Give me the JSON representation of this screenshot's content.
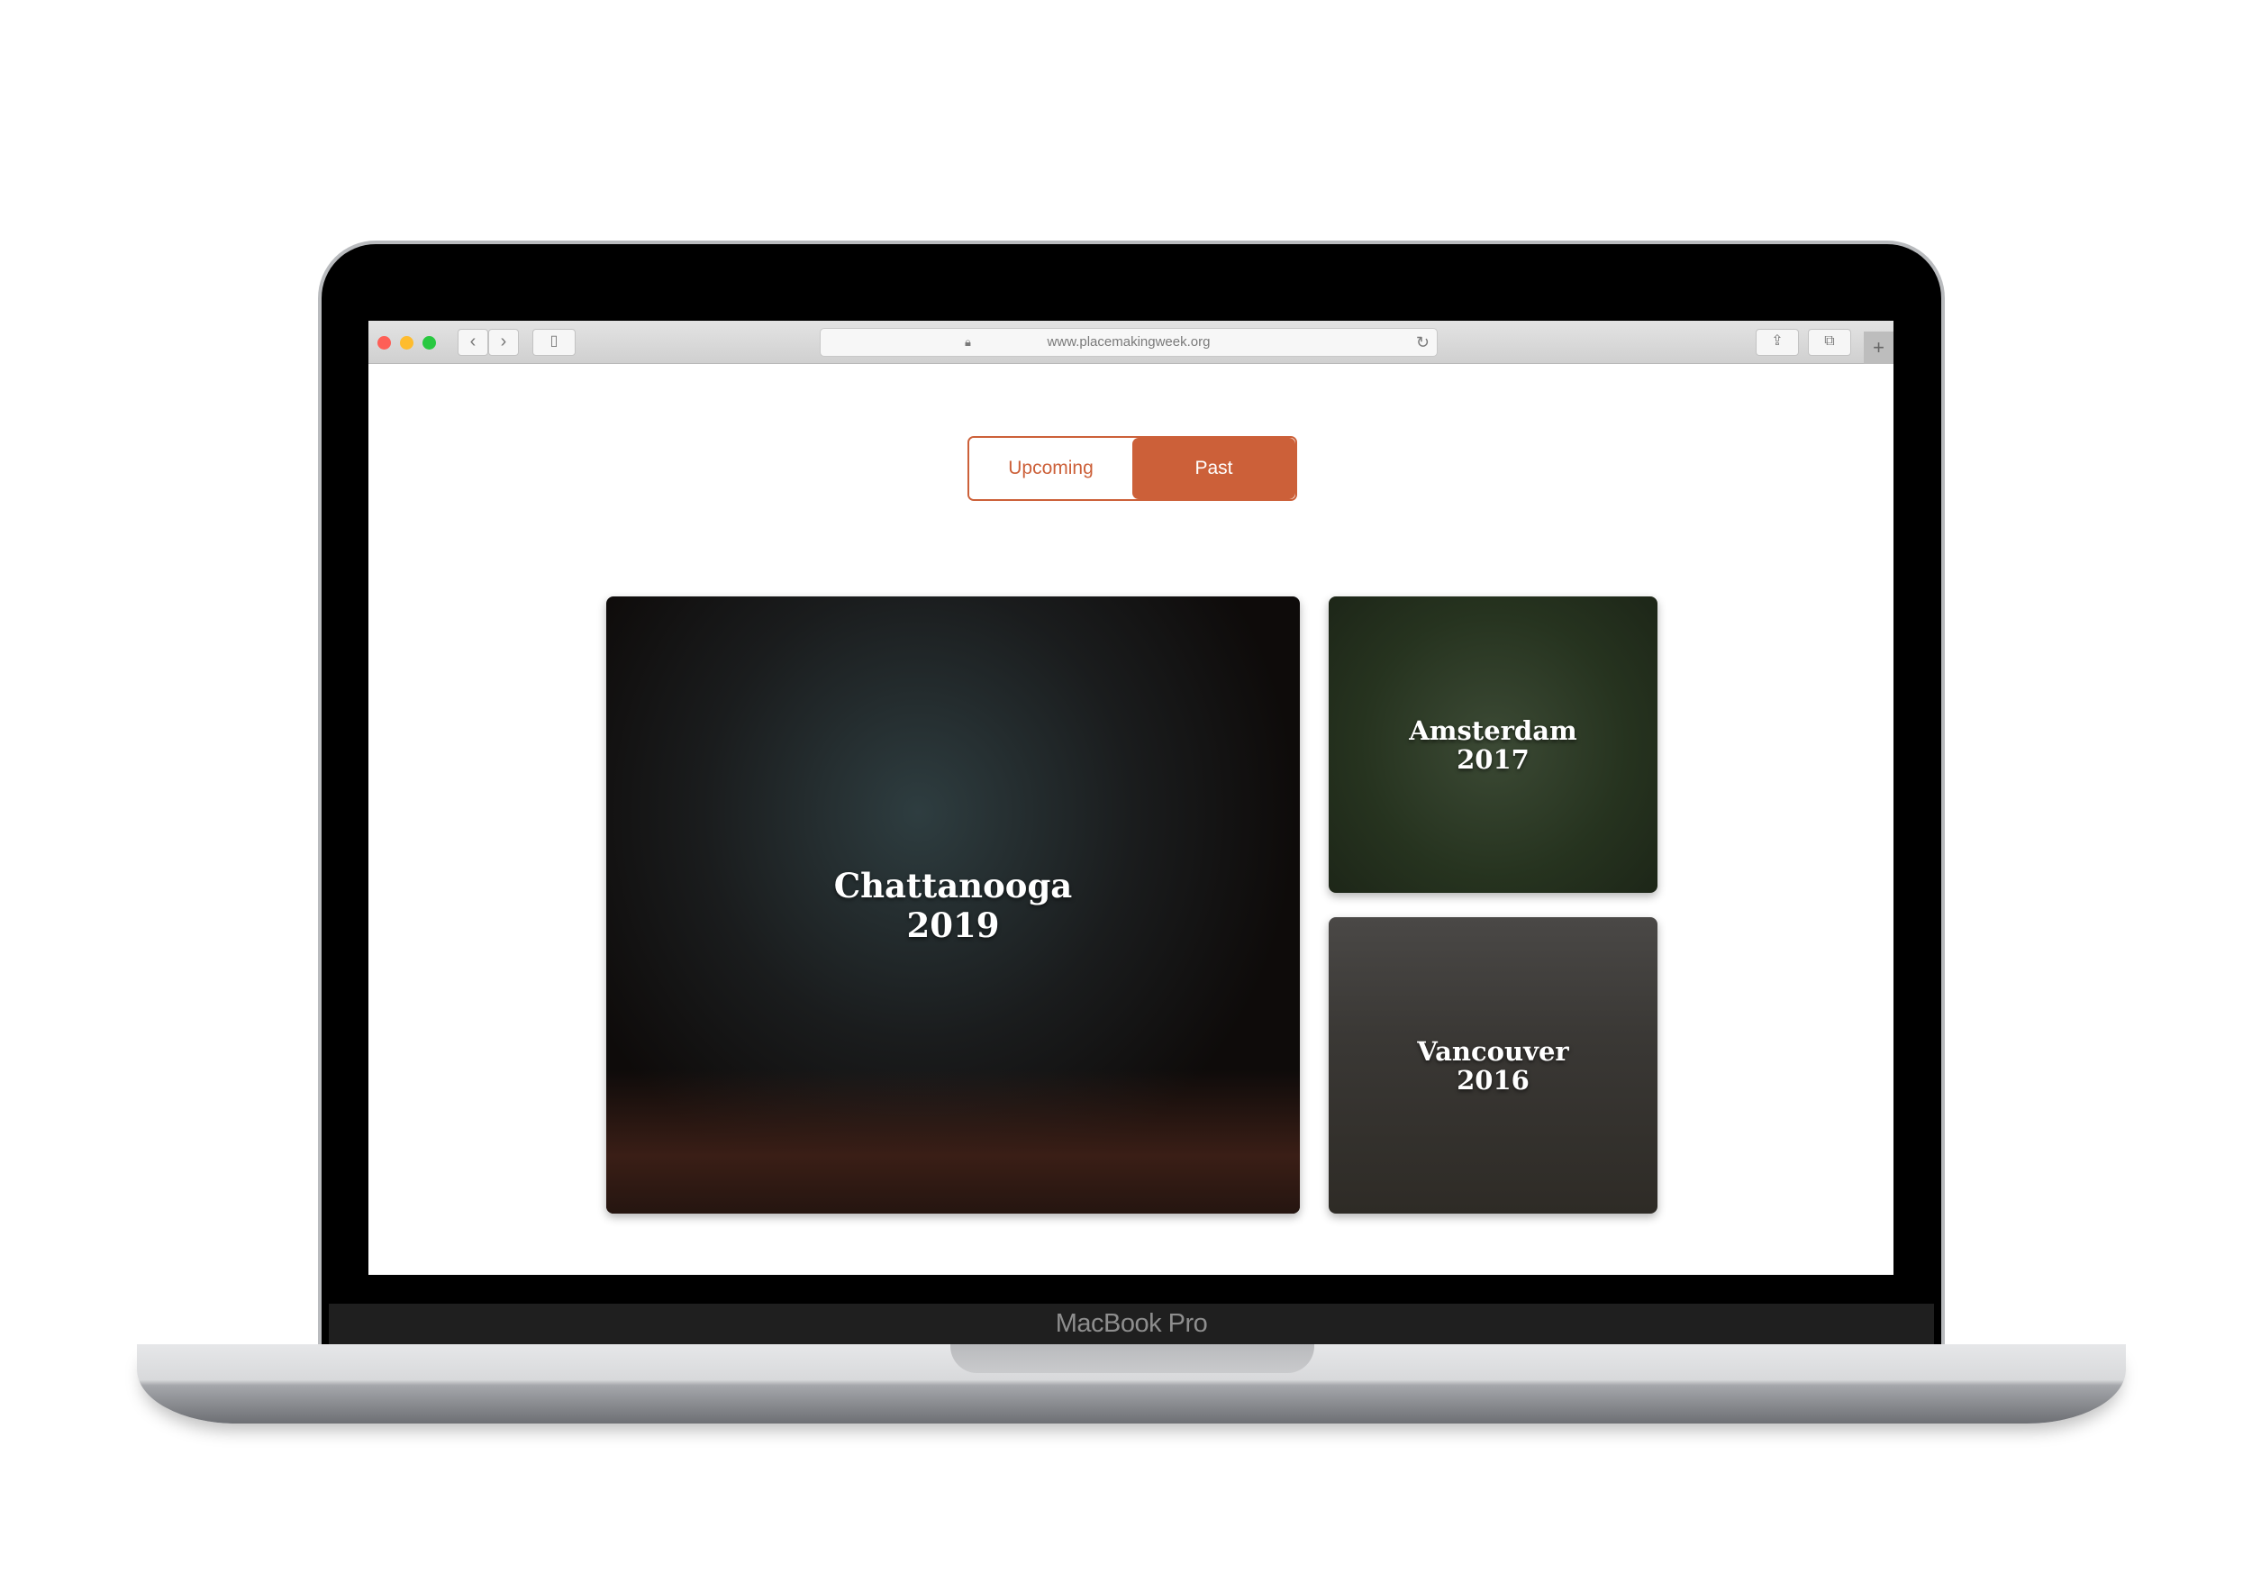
{
  "device": {
    "label": "MacBook Pro"
  },
  "browser": {
    "url": "www.placemakingweek.org",
    "traffic_lights": [
      "#fe5f57",
      "#febc2e",
      "#28c840"
    ]
  },
  "tabs": {
    "upcoming": "Upcoming",
    "past": "Past",
    "active": "Past",
    "accent": "#cc6039"
  },
  "events": [
    {
      "city": "Chattanooga",
      "year": "2019"
    },
    {
      "city": "Amsterdam",
      "year": "2017"
    },
    {
      "city": "Vancouver",
      "year": "2016"
    }
  ]
}
